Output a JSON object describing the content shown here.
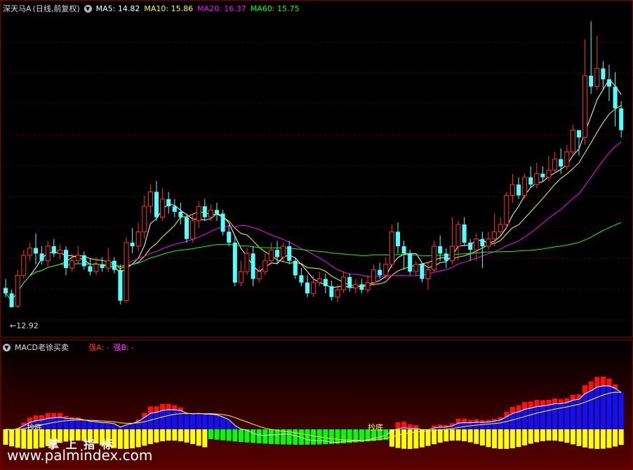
{
  "header": {
    "name": "深天马A",
    "period": "(日线,前复权)",
    "ma5_label": "MA5:",
    "ma5_value": "14.82",
    "ma10_label": "MA10:",
    "ma10_value": "15.86",
    "ma20_label": "MA20:",
    "ma20_value": "16.37",
    "ma60_label": "MA60:",
    "ma60_value": "15.75"
  },
  "low_marker": "←12.92",
  "indicator": {
    "name": "MACD老徐买卖",
    "strong_a": "强A: -",
    "strong_b": "强B: -",
    "signal_1": "抄底",
    "signal_2": "抄底"
  },
  "watermark": {
    "title": "掌 上 指 标",
    "url": "www.palmindex.com"
  },
  "colors": {
    "up": "#ff3232",
    "down": "#54ffff",
    "ma5": "#ffffff",
    "ma10": "#ffff00",
    "ma20": "#ff00ff",
    "ma60": "#00ff00",
    "bar_blue": "#1010ff",
    "bar_red": "#ff1010",
    "bar_yellow": "#ffff00",
    "bar_green": "#00ff00"
  },
  "chart_data": {
    "type": "candlestick",
    "price_ylim": [
      12.3,
      21.0
    ],
    "candles": [
      [
        13.45,
        13.3,
        13.7,
        13.2
      ],
      [
        13.3,
        12.92,
        13.4,
        12.92
      ],
      [
        12.95,
        13.8,
        13.95,
        12.9
      ],
      [
        13.8,
        14.35,
        14.5,
        13.7
      ],
      [
        14.35,
        14.55,
        14.7,
        14.2
      ],
      [
        14.55,
        14.4,
        14.95,
        14.1
      ],
      [
        14.4,
        14.2,
        14.6,
        14.1
      ],
      [
        14.2,
        14.6,
        14.75,
        14.0
      ],
      [
        14.6,
        14.4,
        14.8,
        14.3
      ],
      [
        14.4,
        14.5,
        14.65,
        14.25
      ],
      [
        14.5,
        14.0,
        14.6,
        13.8
      ],
      [
        14.0,
        14.2,
        14.4,
        13.9
      ],
      [
        14.2,
        14.35,
        14.6,
        14.1
      ],
      [
        14.35,
        14.05,
        14.45,
        13.95
      ],
      [
        14.05,
        13.9,
        14.25,
        13.8
      ],
      [
        13.9,
        14.1,
        14.3,
        13.8
      ],
      [
        14.1,
        14.0,
        14.3,
        13.9
      ],
      [
        14.0,
        14.2,
        14.55,
        13.9
      ],
      [
        14.2,
        13.95,
        14.3,
        13.85
      ],
      [
        13.95,
        13.1,
        14.1,
        13.0
      ],
      [
        13.1,
        14.7,
        14.85,
        13.05
      ],
      [
        14.7,
        14.6,
        15.1,
        14.4
      ],
      [
        14.6,
        15.0,
        15.25,
        14.45
      ],
      [
        15.0,
        15.7,
        16.0,
        14.8
      ],
      [
        15.7,
        16.1,
        16.3,
        15.5
      ],
      [
        16.1,
        15.4,
        16.4,
        15.3
      ],
      [
        15.4,
        15.9,
        16.2,
        15.3
      ],
      [
        15.9,
        15.7,
        16.1,
        15.5
      ],
      [
        15.7,
        15.55,
        15.9,
        15.4
      ],
      [
        15.55,
        15.4,
        15.8,
        15.2
      ],
      [
        15.4,
        14.8,
        15.5,
        14.7
      ],
      [
        14.8,
        15.3,
        15.5,
        14.7
      ],
      [
        15.3,
        15.7,
        15.85,
        15.1
      ],
      [
        15.7,
        15.4,
        15.9,
        15.3
      ],
      [
        15.4,
        15.6,
        15.75,
        15.3
      ],
      [
        15.6,
        15.5,
        15.8,
        15.3
      ],
      [
        15.5,
        15.0,
        15.6,
        14.9
      ],
      [
        15.0,
        14.7,
        15.2,
        14.6
      ],
      [
        14.7,
        13.6,
        14.9,
        13.5
      ],
      [
        13.6,
        13.9,
        14.2,
        13.5
      ],
      [
        13.9,
        14.4,
        14.55,
        13.8
      ],
      [
        14.4,
        13.7,
        14.6,
        13.5
      ],
      [
        13.7,
        13.9,
        14.05,
        13.6
      ],
      [
        13.9,
        14.2,
        14.4,
        13.8
      ],
      [
        14.2,
        14.5,
        14.7,
        14.1
      ],
      [
        14.5,
        14.3,
        14.75,
        14.1
      ],
      [
        14.3,
        14.6,
        14.7,
        14.2
      ],
      [
        14.6,
        14.2,
        14.75,
        14.1
      ],
      [
        14.2,
        13.8,
        14.3,
        13.7
      ],
      [
        13.8,
        13.6,
        14.0,
        13.5
      ],
      [
        13.6,
        13.3,
        13.8,
        13.2
      ],
      [
        13.3,
        13.6,
        13.8,
        13.2
      ],
      [
        13.6,
        13.7,
        13.9,
        13.5
      ],
      [
        13.7,
        13.5,
        13.85,
        13.3
      ],
      [
        13.5,
        13.2,
        13.65,
        13.1
      ],
      [
        13.2,
        13.4,
        13.55,
        13.05
      ],
      [
        13.4,
        13.75,
        13.9,
        13.3
      ],
      [
        13.75,
        13.45,
        13.85,
        13.35
      ],
      [
        13.45,
        13.55,
        13.7,
        13.3
      ],
      [
        13.55,
        13.4,
        13.7,
        13.3
      ],
      [
        13.4,
        13.6,
        13.8,
        13.3
      ],
      [
        13.6,
        13.95,
        14.1,
        13.5
      ],
      [
        13.95,
        13.8,
        14.15,
        13.7
      ],
      [
        13.8,
        14.1,
        14.3,
        13.7
      ],
      [
        14.1,
        15.0,
        15.2,
        14.0
      ],
      [
        15.0,
        14.6,
        15.25,
        14.4
      ],
      [
        14.6,
        14.4,
        14.75,
        13.95
      ],
      [
        14.4,
        13.9,
        14.5,
        13.8
      ],
      [
        13.9,
        14.1,
        14.2,
        13.8
      ],
      [
        14.1,
        13.7,
        14.15,
        13.6
      ],
      [
        13.7,
        13.95,
        14.15,
        13.4
      ],
      [
        13.95,
        14.6,
        14.75,
        13.9
      ],
      [
        14.6,
        14.4,
        14.9,
        14.2
      ],
      [
        14.4,
        14.2,
        14.55,
        14.0
      ],
      [
        14.2,
        14.6,
        15.4,
        14.1
      ],
      [
        14.6,
        15.2,
        15.3,
        14.2
      ],
      [
        15.2,
        14.7,
        15.4,
        14.6
      ],
      [
        14.7,
        14.5,
        14.8,
        14.2
      ],
      [
        14.5,
        14.8,
        14.95,
        14.2
      ],
      [
        14.8,
        14.6,
        15.0,
        14.0
      ],
      [
        14.6,
        14.8,
        15.0,
        14.5
      ],
      [
        14.8,
        15.0,
        15.5,
        14.6
      ],
      [
        15.0,
        15.2,
        15.4,
        14.9
      ],
      [
        15.2,
        16.0,
        16.1,
        15.1
      ],
      [
        16.0,
        16.3,
        16.6,
        15.8
      ],
      [
        16.3,
        16.0,
        16.5,
        15.9
      ],
      [
        16.0,
        16.5,
        16.6,
        15.9
      ],
      [
        16.5,
        16.3,
        16.8,
        16.2
      ],
      [
        16.3,
        16.6,
        16.9,
        16.2
      ],
      [
        16.6,
        16.5,
        16.8,
        16.4
      ],
      [
        16.5,
        16.7,
        17.1,
        16.4
      ],
      [
        16.7,
        17.0,
        17.2,
        16.6
      ],
      [
        17.0,
        16.8,
        17.3,
        16.6
      ],
      [
        16.8,
        17.2,
        17.4,
        16.7
      ],
      [
        17.2,
        17.8,
        17.95,
        17.1
      ],
      [
        17.8,
        17.6,
        17.8,
        17.1
      ],
      [
        17.6,
        19.3,
        20.3,
        17.4
      ],
      [
        19.3,
        19.0,
        20.8,
        18.8
      ],
      [
        19.0,
        19.5,
        20.4,
        18.9
      ],
      [
        19.5,
        19.2,
        19.7,
        18.9
      ],
      [
        19.2,
        19.0,
        19.6,
        18.6
      ],
      [
        19.0,
        18.4,
        19.4,
        17.9
      ],
      [
        18.4,
        17.8,
        18.6,
        17.6
      ]
    ],
    "ma_periods": [
      5,
      10,
      20,
      60
    ],
    "macd_segments": [
      {
        "from": 0,
        "to": 34,
        "color": "bar_yellow",
        "label": "抄底"
      },
      {
        "from": 34,
        "to": 64,
        "color": "bar_green"
      },
      {
        "from": 64,
        "to": 103,
        "color": "bar_yellow",
        "label": "抄底"
      }
    ]
  }
}
